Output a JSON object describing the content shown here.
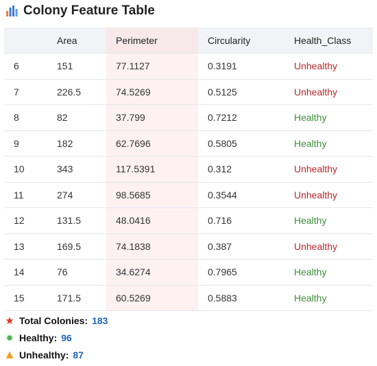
{
  "header": {
    "title": "Colony Feature Table",
    "icon": "bar-chart-icon"
  },
  "table": {
    "columns": [
      "",
      "Area",
      "Perimeter",
      "Circularity",
      "Health_Class"
    ],
    "rows": [
      {
        "index": "6",
        "area": "151",
        "perimeter": "77.1127",
        "circularity": "0.3191",
        "health": "Unhealthy"
      },
      {
        "index": "7",
        "area": "226.5",
        "perimeter": "74.5269",
        "circularity": "0.5125",
        "health": "Unhealthy"
      },
      {
        "index": "8",
        "area": "82",
        "perimeter": "37.799",
        "circularity": "0.7212",
        "health": "Healthy"
      },
      {
        "index": "9",
        "area": "182",
        "perimeter": "62.7696",
        "circularity": "0.5805",
        "health": "Healthy"
      },
      {
        "index": "10",
        "area": "343",
        "perimeter": "117.5391",
        "circularity": "0.312",
        "health": "Unhealthy"
      },
      {
        "index": "11",
        "area": "274",
        "perimeter": "98.5685",
        "circularity": "0.3544",
        "health": "Unhealthy"
      },
      {
        "index": "12",
        "area": "131.5",
        "perimeter": "48.0416",
        "circularity": "0.716",
        "health": "Healthy"
      },
      {
        "index": "13",
        "area": "169.5",
        "perimeter": "74.1838",
        "circularity": "0.387",
        "health": "Unhealthy"
      },
      {
        "index": "14",
        "area": "76",
        "perimeter": "34.6274",
        "circularity": "0.7965",
        "health": "Healthy"
      },
      {
        "index": "15",
        "area": "171.5",
        "perimeter": "60.5269",
        "circularity": "0.5883",
        "health": "Healthy"
      }
    ]
  },
  "summary": {
    "total_label": "Total Colonies:",
    "total_value": "183",
    "healthy_label": "Healthy:",
    "healthy_value": "96",
    "unhealthy_label": "Unhealthy:",
    "unhealthy_value": "87"
  },
  "colors": {
    "healthy": "#3f8c3a",
    "unhealthy": "#b3282d",
    "value_blue": "#1f66b5",
    "star_red": "#d93a2f",
    "dot_green": "#4caf50",
    "triangle_orange": "#f0a020"
  }
}
